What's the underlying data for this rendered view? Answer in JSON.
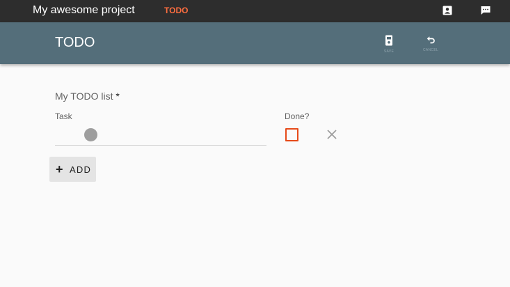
{
  "topbar": {
    "app_title": "My awesome project",
    "nav_todo": "TODO",
    "accent_color": "#ff6e40",
    "icons": [
      "contacts-icon",
      "chat-icon"
    ]
  },
  "toolbar": {
    "title": "TODO",
    "save_label": "SAVE",
    "cancel_label": "CANCEL",
    "icons": [
      "save-icon",
      "undo-icon"
    ],
    "background_color": "#546e7a"
  },
  "form": {
    "list_label": "My TODO list",
    "required_mark": "*",
    "task_label": "Task",
    "done_label": "Done?",
    "add_label": "ADD",
    "add_icon": "plus-icon",
    "remove_icon": "close-icon",
    "done_checked": false,
    "checkbox_color": "#e64a19"
  }
}
